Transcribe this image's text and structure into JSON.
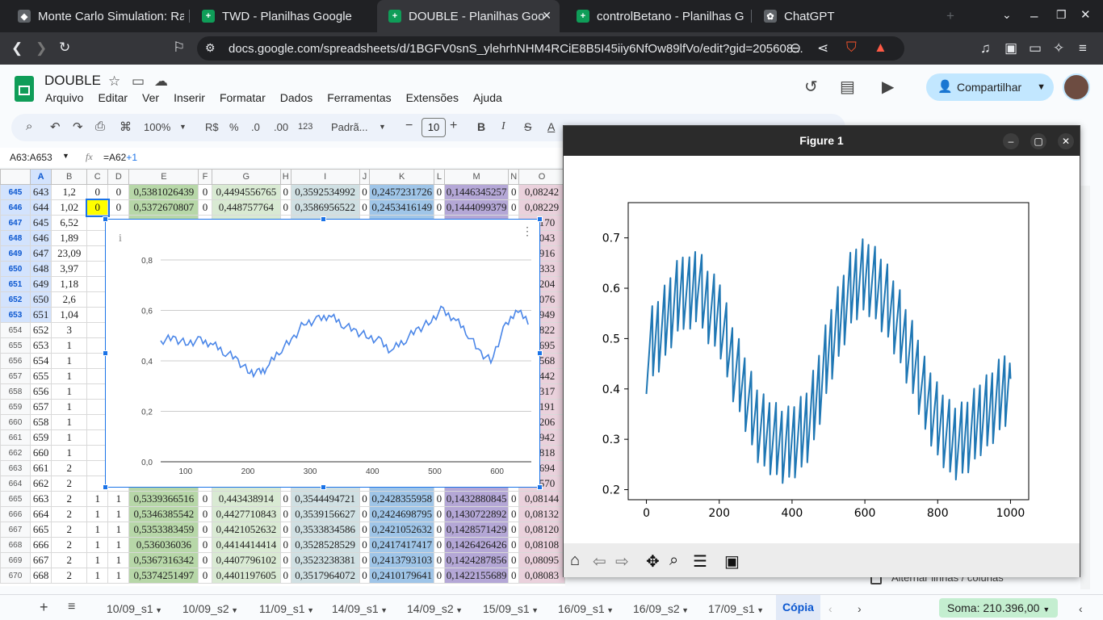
{
  "browser": {
    "tabs": [
      {
        "title": "Monte Carlo Simulation: Ra",
        "icon": "generic-icon"
      },
      {
        "title": "TWD - Planilhas Google",
        "icon": "sheets-icon"
      },
      {
        "title": "DOUBLE - Planilhas Goo",
        "icon": "sheets-icon",
        "active": true
      },
      {
        "title": "controlBetano - Planilhas G",
        "icon": "sheets-icon"
      },
      {
        "title": "ChatGPT",
        "icon": "chatgpt-icon"
      }
    ],
    "url": "docs.google.com/spreadsheets/d/1BGFV0snS_ylehrhNHM4RCiE8B5I45iiy6NfOw89lfVo/edit?gid=205608..."
  },
  "doc": {
    "title": "DOUBLE",
    "menu": [
      "Arquivo",
      "Editar",
      "Ver",
      "Inserir",
      "Formatar",
      "Dados",
      "Ferramentas",
      "Extensões",
      "Ajuda"
    ],
    "share_label": "Compartilhar"
  },
  "toolbar": {
    "zoom": "100%",
    "currency": "R$",
    "percent": "%",
    "dec_less": ".0",
    "dec_more": ".00",
    "format_num": "123",
    "font": "Padrã...",
    "font_size": "10",
    "bold": "B",
    "italic": "I",
    "strike": "S",
    "textcolor": "A"
  },
  "formula": {
    "range": "A63:A653",
    "fx": "fx",
    "ref": "=A62",
    "op": "+1"
  },
  "columns": [
    "A",
    "B",
    "C",
    "D",
    "E",
    "F",
    "G",
    "H",
    "I",
    "J",
    "K",
    "L",
    "M",
    "N",
    "O"
  ],
  "rows": [
    {
      "rn": "645",
      "a": "643",
      "b": "1,2",
      "c": "0",
      "d": "0",
      "e": "0,5381026439",
      "f": "0",
      "g": "0,4494556765",
      "h": "0",
      "i": "0,3592534992",
      "j": "0",
      "k": "0,2457231726",
      "l": "0",
      "m": "0,1446345257",
      "n": "0",
      "o": "0,08242",
      "sel": true
    },
    {
      "rn": "646",
      "a": "644",
      "b": "1,02",
      "c": "0",
      "d": "0",
      "e": "0,5372670807",
      "f": "0",
      "g": "0,448757764",
      "h": "0",
      "i": "0,3586956522",
      "j": "0",
      "k": "0,2453416149",
      "l": "0",
      "m": "0,1444099379",
      "n": "0",
      "o": "0,08229",
      "sel": true
    },
    {
      "rn": "647",
      "a": "645",
      "b": "6,52",
      "sel": true,
      "o": "82170"
    },
    {
      "rn": "648",
      "a": "646",
      "b": "1,89",
      "sel": true,
      "o": "82043"
    },
    {
      "rn": "649",
      "a": "647",
      "b": "23,09",
      "sel": true,
      "o": "81916"
    },
    {
      "rn": "650",
      "a": "648",
      "b": "3,97",
      "sel": true,
      "o": "83333"
    },
    {
      "rn": "651",
      "a": "649",
      "b": "1,18",
      "sel": true,
      "o": "83204"
    },
    {
      "rn": "652",
      "a": "650",
      "b": "2,6",
      "sel": true,
      "o": "83076"
    },
    {
      "rn": "653",
      "a": "651",
      "b": "1,04",
      "sel": true,
      "o": "82949"
    },
    {
      "rn": "654",
      "a": "652",
      "b": "3",
      "o": "82822"
    },
    {
      "rn": "655",
      "a": "653",
      "b": "1",
      "o": "82695"
    },
    {
      "rn": "656",
      "a": "654",
      "b": "1",
      "o": "82568"
    },
    {
      "rn": "657",
      "a": "655",
      "b": "1",
      "o": "82442"
    },
    {
      "rn": "658",
      "a": "656",
      "b": "1",
      "o": "82317"
    },
    {
      "rn": "659",
      "a": "657",
      "b": "1",
      "o": "82191"
    },
    {
      "rn": "660",
      "a": "658",
      "b": "1",
      "o": "08206"
    },
    {
      "rn": "661",
      "a": "659",
      "b": "1",
      "o": "81942"
    },
    {
      "rn": "662",
      "a": "660",
      "b": "1",
      "o": "81818"
    },
    {
      "rn": "663",
      "a": "661",
      "b": "2",
      "o": "81694"
    },
    {
      "rn": "664",
      "a": "662",
      "b": "2",
      "o": "81570"
    },
    {
      "rn": "665",
      "a": "663",
      "b": "2",
      "c": "1",
      "d": "1",
      "e": "0,5339366516",
      "f": "0",
      "g": "0,443438914",
      "h": "0",
      "i": "0,3544494721",
      "j": "0",
      "k": "0,2428355958",
      "l": "0",
      "m": "0,1432880845",
      "n": "0",
      "o": "0,08144"
    },
    {
      "rn": "666",
      "a": "664",
      "b": "2",
      "c": "1",
      "d": "1",
      "e": "0,5346385542",
      "f": "0",
      "g": "0,4427710843",
      "h": "0",
      "i": "0,3539156627",
      "j": "0",
      "k": "0,2424698795",
      "l": "0",
      "m": "0,1430722892",
      "n": "0",
      "o": "0,08132"
    },
    {
      "rn": "667",
      "a": "665",
      "b": "2",
      "c": "1",
      "d": "1",
      "e": "0,5353383459",
      "f": "0",
      "g": "0,4421052632",
      "h": "0",
      "i": "0,3533834586",
      "j": "0",
      "k": "0,2421052632",
      "l": "0",
      "m": "0,1428571429",
      "n": "0",
      "o": "0,08120"
    },
    {
      "rn": "668",
      "a": "666",
      "b": "2",
      "c": "1",
      "d": "1",
      "e": "0,536036036",
      "f": "0",
      "g": "0,4414414414",
      "h": "0",
      "i": "0,3528528529",
      "j": "0",
      "k": "0,2417417417",
      "l": "0",
      "m": "0,1426426426",
      "n": "0",
      "o": "0,08108"
    },
    {
      "rn": "669",
      "a": "667",
      "b": "2",
      "c": "1",
      "d": "1",
      "e": "0,5367316342",
      "f": "0",
      "g": "0,4407796102",
      "h": "0",
      "i": "0,3523238381",
      "j": "0",
      "k": "0,2413793103",
      "l": "0",
      "m": "0,1424287856",
      "n": "0",
      "o": "0,08095"
    },
    {
      "rn": "670",
      "a": "668",
      "b": "2",
      "c": "1",
      "d": "1",
      "e": "0,5374251497",
      "f": "0",
      "g": "0,4401197605",
      "h": "0",
      "i": "0,3517964072",
      "j": "0",
      "k": "0,2410179641",
      "l": "0",
      "m": "0,1422155689",
      "n": "0",
      "o": "0,08083"
    }
  ],
  "chart_data": [
    {
      "type": "line",
      "title": "",
      "xlabel": "",
      "ylabel": "",
      "xticks": [
        "100",
        "200",
        "300",
        "400",
        "500",
        "600"
      ],
      "yticks": [
        "0,0",
        "0,2",
        "0,4",
        "0,6",
        "0,8"
      ],
      "xlim": [
        60,
        655
      ],
      "ylim": [
        0,
        0.8
      ],
      "color": "#4a86e8",
      "x": [
        60,
        80,
        100,
        120,
        140,
        160,
        180,
        200,
        215,
        230,
        250,
        270,
        290,
        310,
        330,
        350,
        370,
        390,
        410,
        430,
        450,
        470,
        490,
        510,
        530,
        550,
        570,
        590,
        610,
        630,
        650
      ],
      "y": [
        0.48,
        0.49,
        0.47,
        0.48,
        0.47,
        0.44,
        0.41,
        0.36,
        0.35,
        0.37,
        0.44,
        0.48,
        0.55,
        0.56,
        0.58,
        0.55,
        0.52,
        0.5,
        0.48,
        0.44,
        0.48,
        0.52,
        0.55,
        0.6,
        0.57,
        0.52,
        0.44,
        0.4,
        0.52,
        0.6,
        0.56
      ]
    },
    {
      "type": "line",
      "title": "Figure 1",
      "xlabel": "",
      "ylabel": "",
      "xticks": [
        "0",
        "200",
        "400",
        "600",
        "800",
        "1000"
      ],
      "yticks": [
        "0.2",
        "0.3",
        "0.4",
        "0.5",
        "0.6",
        "0.7"
      ],
      "xlim": [
        -50,
        1050
      ],
      "ylim": [
        0.18,
        0.77
      ],
      "color": "#1f77b4",
      "x": [
        0,
        20,
        40,
        60,
        80,
        100,
        120,
        140,
        160,
        180,
        200,
        220,
        240,
        260,
        280,
        300,
        320,
        340,
        360,
        380,
        400,
        420,
        440,
        460,
        480,
        500,
        520,
        540,
        560,
        580,
        600,
        620,
        640,
        660,
        680,
        700,
        720,
        740,
        760,
        780,
        800,
        820,
        840,
        860,
        880,
        900,
        920,
        940,
        960,
        980,
        1000
      ],
      "y": [
        0.47,
        0.5,
        0.52,
        0.55,
        0.58,
        0.6,
        0.59,
        0.62,
        0.58,
        0.56,
        0.55,
        0.5,
        0.45,
        0.42,
        0.38,
        0.34,
        0.32,
        0.31,
        0.3,
        0.29,
        0.3,
        0.31,
        0.33,
        0.37,
        0.42,
        0.48,
        0.52,
        0.56,
        0.6,
        0.62,
        0.63,
        0.62,
        0.6,
        0.58,
        0.55,
        0.52,
        0.48,
        0.45,
        0.4,
        0.37,
        0.34,
        0.32,
        0.3,
        0.3,
        0.31,
        0.33,
        0.35,
        0.36,
        0.38,
        0.4,
        0.42
      ]
    }
  ],
  "figure": {
    "title": "Figure 1",
    "tools": [
      "home-icon",
      "back-icon",
      "forward-icon",
      "pan-icon",
      "zoom-icon",
      "configure-icon",
      "save-icon"
    ]
  },
  "sheets": {
    "tabs": [
      "10/09_s1",
      "10/09_s2",
      "11/09_s1",
      "14/09_s1",
      "14/09_s2",
      "15/09_s1",
      "16/09_s1",
      "16/09_s2",
      "17/09_s1",
      "Cópia"
    ],
    "sum_label": "Soma: 210.396,00",
    "side_text": "Alternar linhas / colunas"
  }
}
